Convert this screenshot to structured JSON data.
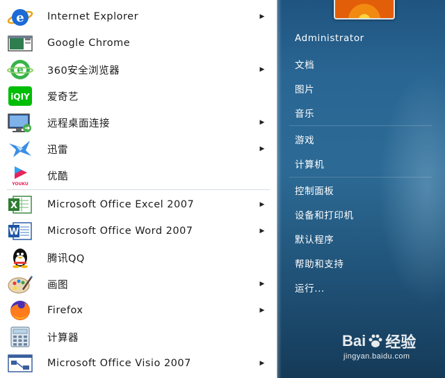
{
  "programs": [
    {
      "label": "Internet Explorer",
      "icon": "internet-explorer-icon",
      "has_submenu": true
    },
    {
      "label": "Google Chrome",
      "icon": "google-chrome-icon",
      "has_submenu": false
    },
    {
      "label": "360安全浏览器",
      "icon": "360-browser-icon",
      "has_submenu": true
    },
    {
      "label": "爱奇艺",
      "icon": "iqiyi-icon",
      "has_submenu": false
    },
    {
      "label": "远程桌面连接",
      "icon": "remote-desktop-icon",
      "has_submenu": true
    },
    {
      "label": "迅雷",
      "icon": "thunder-icon",
      "has_submenu": true
    },
    {
      "label": "优酷",
      "icon": "youku-icon",
      "has_submenu": false
    },
    {
      "label": "Microsoft Office Excel 2007",
      "icon": "excel-icon",
      "has_submenu": true
    },
    {
      "label": "Microsoft Office Word 2007",
      "icon": "word-icon",
      "has_submenu": true
    },
    {
      "label": "腾讯QQ",
      "icon": "qq-icon",
      "has_submenu": false
    },
    {
      "label": "画图",
      "icon": "paint-icon",
      "has_submenu": true
    },
    {
      "label": "Firefox",
      "icon": "firefox-icon",
      "has_submenu": true
    },
    {
      "label": "计算器",
      "icon": "calculator-icon",
      "has_submenu": false
    },
    {
      "label": "Microsoft Office Visio 2007",
      "icon": "visio-icon",
      "has_submenu": true
    }
  ],
  "submenu_arrow": "▶",
  "right_panel": {
    "user": "Administrator",
    "items": [
      "文档",
      "图片",
      "音乐",
      "游戏",
      "计算机",
      "控制面板",
      "设备和打印机",
      "默认程序",
      "帮助和支持",
      "运行..."
    ]
  },
  "watermark": {
    "brand_left": "Bai",
    "brand_right": "经验",
    "url": "jingyan.baidu.com"
  },
  "colors": {
    "menu_background": "#ffffff",
    "right_panel_background": "#2c6a95",
    "right_text": "#ffffff"
  }
}
